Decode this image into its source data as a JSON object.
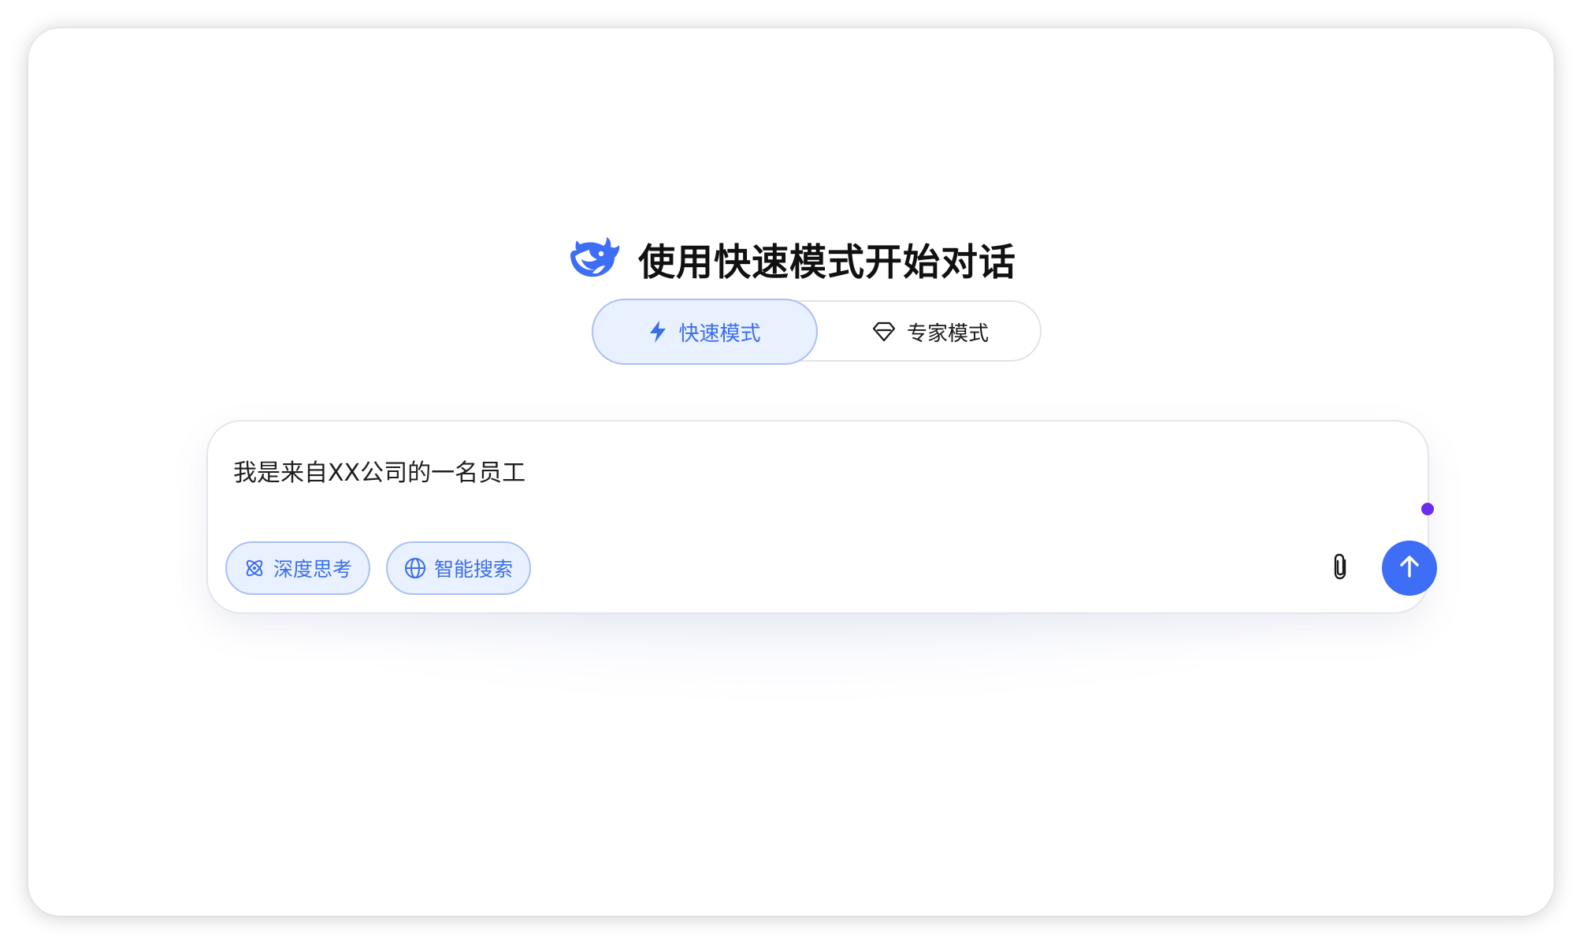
{
  "heading": {
    "title": "使用快速模式开始对话",
    "logo_icon": "deepseek-whale-icon"
  },
  "modes": [
    {
      "label": "快速模式",
      "icon": "lightning-bolt-icon",
      "selected": true
    },
    {
      "label": "专家模式",
      "icon": "diamond-icon",
      "selected": false
    }
  ],
  "composer": {
    "value": "我是来自XX公司的一名员工",
    "chips": [
      {
        "label": "深度思考",
        "icon": "atom-icon",
        "active": true
      },
      {
        "label": "智能搜索",
        "icon": "globe-icon",
        "active": true
      }
    ],
    "attach_icon": "paperclip-icon",
    "send_icon": "arrow-up-icon"
  },
  "colors": {
    "accent": "#3d6ef5",
    "accent_light_bg": "#e9f0ff",
    "accent_border": "#a9c1f4",
    "status_dot": "#6b2cf0",
    "text": "#111111"
  }
}
